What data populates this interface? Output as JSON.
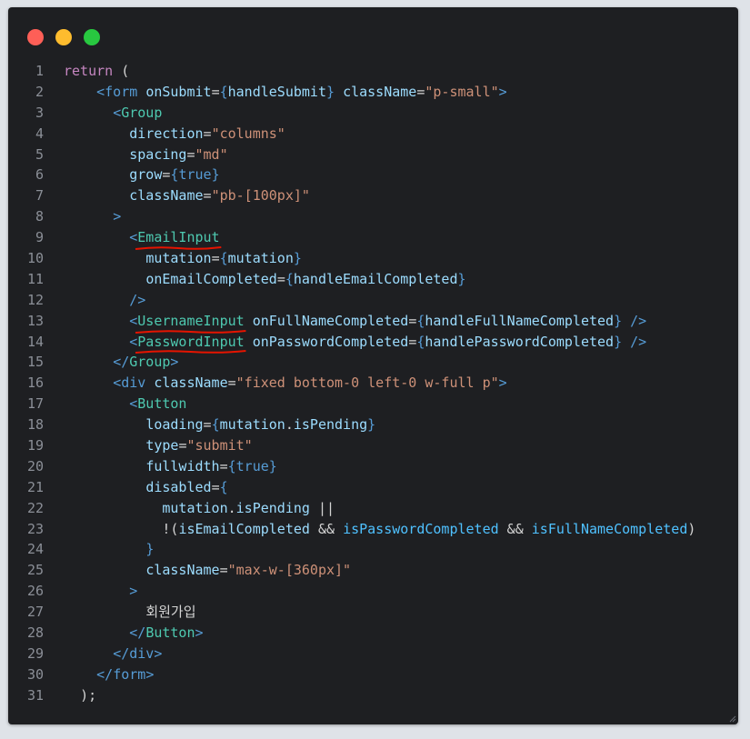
{
  "window": {
    "buttons": [
      "close",
      "minimize",
      "maximize"
    ]
  },
  "code_lines": [
    {
      "n": "1",
      "indent": "",
      "tokens": [
        [
          "kw",
          "return"
        ],
        [
          "op",
          " ("
        ]
      ]
    },
    {
      "n": "2",
      "indent": "    ",
      "tokens": [
        [
          "br",
          "<"
        ],
        [
          "br",
          "form"
        ],
        [
          "op",
          " "
        ],
        [
          "attr",
          "onSubmit"
        ],
        [
          "op",
          "="
        ],
        [
          "br",
          "{"
        ],
        [
          "expr",
          "handleSubmit"
        ],
        [
          "br",
          "}"
        ],
        [
          "op",
          " "
        ],
        [
          "attr",
          "className"
        ],
        [
          "op",
          "="
        ],
        [
          "str",
          "\"p-small\""
        ],
        [
          "br",
          ">"
        ]
      ]
    },
    {
      "n": "3",
      "indent": "      ",
      "tokens": [
        [
          "br",
          "<"
        ],
        [
          "tag",
          "Group"
        ]
      ]
    },
    {
      "n": "4",
      "indent": "        ",
      "tokens": [
        [
          "attr",
          "direction"
        ],
        [
          "op",
          "="
        ],
        [
          "str",
          "\"columns\""
        ]
      ]
    },
    {
      "n": "5",
      "indent": "        ",
      "tokens": [
        [
          "attr",
          "spacing"
        ],
        [
          "op",
          "="
        ],
        [
          "str",
          "\"md\""
        ]
      ]
    },
    {
      "n": "6",
      "indent": "        ",
      "tokens": [
        [
          "attr",
          "grow"
        ],
        [
          "op",
          "="
        ],
        [
          "br",
          "{"
        ],
        [
          "bool",
          "true"
        ],
        [
          "br",
          "}"
        ]
      ]
    },
    {
      "n": "7",
      "indent": "        ",
      "tokens": [
        [
          "attr",
          "className"
        ],
        [
          "op",
          "="
        ],
        [
          "str",
          "\"pb-[100px]\""
        ]
      ]
    },
    {
      "n": "8",
      "indent": "      ",
      "tokens": [
        [
          "br",
          ">"
        ]
      ]
    },
    {
      "n": "9",
      "indent": "        ",
      "tokens": [
        [
          "br",
          "<"
        ],
        [
          "tag~",
          "EmailInput"
        ]
      ]
    },
    {
      "n": "10",
      "indent": "          ",
      "tokens": [
        [
          "attr",
          "mutation"
        ],
        [
          "op",
          "="
        ],
        [
          "br",
          "{"
        ],
        [
          "expr",
          "mutation"
        ],
        [
          "br",
          "}"
        ]
      ]
    },
    {
      "n": "11",
      "indent": "          ",
      "tokens": [
        [
          "attr",
          "onEmailCompleted"
        ],
        [
          "op",
          "="
        ],
        [
          "br",
          "{"
        ],
        [
          "expr",
          "handleEmailCompleted"
        ],
        [
          "br",
          "}"
        ]
      ]
    },
    {
      "n": "12",
      "indent": "        ",
      "tokens": [
        [
          "br",
          "/>"
        ]
      ]
    },
    {
      "n": "13",
      "indent": "        ",
      "tokens": [
        [
          "br",
          "<"
        ],
        [
          "tag~",
          "UsernameInput"
        ],
        [
          "op",
          " "
        ],
        [
          "attr",
          "onFullNameCompleted"
        ],
        [
          "op",
          "="
        ],
        [
          "br",
          "{"
        ],
        [
          "expr",
          "handleFullNameCompleted"
        ],
        [
          "br",
          "}"
        ],
        [
          "op",
          " "
        ],
        [
          "br",
          "/>"
        ]
      ]
    },
    {
      "n": "14",
      "indent": "        ",
      "tokens": [
        [
          "br",
          "<"
        ],
        [
          "tag~",
          "PasswordInput"
        ],
        [
          "op",
          " "
        ],
        [
          "attr",
          "onPasswordCompleted"
        ],
        [
          "op",
          "="
        ],
        [
          "br",
          "{"
        ],
        [
          "expr",
          "handlePasswordCompleted"
        ],
        [
          "br",
          "}"
        ],
        [
          "op",
          " "
        ],
        [
          "br",
          "/>"
        ]
      ]
    },
    {
      "n": "15",
      "indent": "      ",
      "tokens": [
        [
          "br",
          "</"
        ],
        [
          "tag",
          "Group"
        ],
        [
          "br",
          ">"
        ]
      ]
    },
    {
      "n": "16",
      "indent": "      ",
      "tokens": [
        [
          "br",
          "<"
        ],
        [
          "br",
          "div"
        ],
        [
          "op",
          " "
        ],
        [
          "attr",
          "className"
        ],
        [
          "op",
          "="
        ],
        [
          "str",
          "\"fixed bottom-0 left-0 w-full p\""
        ],
        [
          "br",
          ">"
        ]
      ]
    },
    {
      "n": "17",
      "indent": "        ",
      "tokens": [
        [
          "br",
          "<"
        ],
        [
          "tag",
          "Button"
        ]
      ]
    },
    {
      "n": "18",
      "indent": "          ",
      "tokens": [
        [
          "attr",
          "loading"
        ],
        [
          "op",
          "="
        ],
        [
          "br",
          "{"
        ],
        [
          "expr",
          "mutation"
        ],
        [
          "op",
          "."
        ],
        [
          "expr",
          "isPending"
        ],
        [
          "br",
          "}"
        ]
      ]
    },
    {
      "n": "19",
      "indent": "          ",
      "tokens": [
        [
          "attr",
          "type"
        ],
        [
          "op",
          "="
        ],
        [
          "str",
          "\"submit\""
        ]
      ]
    },
    {
      "n": "20",
      "indent": "          ",
      "tokens": [
        [
          "attr",
          "fullwidth"
        ],
        [
          "op",
          "="
        ],
        [
          "br",
          "{"
        ],
        [
          "bool",
          "true"
        ],
        [
          "br",
          "}"
        ]
      ]
    },
    {
      "n": "21",
      "indent": "          ",
      "tokens": [
        [
          "attr",
          "disabled"
        ],
        [
          "op",
          "="
        ],
        [
          "br",
          "{"
        ]
      ]
    },
    {
      "n": "22",
      "indent": "            ",
      "tokens": [
        [
          "expr",
          "mutation"
        ],
        [
          "op",
          "."
        ],
        [
          "expr",
          "isPending"
        ],
        [
          "op",
          " ||"
        ]
      ]
    },
    {
      "n": "23",
      "indent": "            ",
      "tokens": [
        [
          "op",
          "!("
        ],
        [
          "expr",
          "isEmailCompleted"
        ],
        [
          "op",
          " && "
        ],
        [
          "ident",
          "isPasswordCompleted"
        ],
        [
          "op",
          " && "
        ],
        [
          "ident",
          "isFullNameCompleted"
        ],
        [
          "op",
          ")"
        ]
      ]
    },
    {
      "n": "24",
      "indent": "          ",
      "tokens": [
        [
          "br",
          "}"
        ]
      ]
    },
    {
      "n": "25",
      "indent": "          ",
      "tokens": [
        [
          "attr",
          "className"
        ],
        [
          "op",
          "="
        ],
        [
          "str",
          "\"max-w-[360px]\""
        ]
      ]
    },
    {
      "n": "26",
      "indent": "        ",
      "tokens": [
        [
          "br",
          ">"
        ]
      ]
    },
    {
      "n": "27",
      "indent": "          ",
      "tokens": [
        [
          "text",
          "회원가입"
        ]
      ]
    },
    {
      "n": "28",
      "indent": "        ",
      "tokens": [
        [
          "br",
          "</"
        ],
        [
          "tag",
          "Button"
        ],
        [
          "br",
          ">"
        ]
      ]
    },
    {
      "n": "29",
      "indent": "      ",
      "tokens": [
        [
          "br",
          "</"
        ],
        [
          "br",
          "div"
        ],
        [
          "br",
          ">"
        ]
      ]
    },
    {
      "n": "30",
      "indent": "    ",
      "tokens": [
        [
          "br",
          "</"
        ],
        [
          "br",
          "form"
        ],
        [
          "br",
          ">"
        ]
      ]
    },
    {
      "n": "31",
      "indent": "  ",
      "tokens": [
        [
          "op",
          ");"
        ]
      ]
    }
  ],
  "colors": {
    "background": "#1e1f22",
    "close": "#fe5f57",
    "minimize": "#febc2e",
    "maximize": "#28c840",
    "squiggle": "#e51400"
  }
}
